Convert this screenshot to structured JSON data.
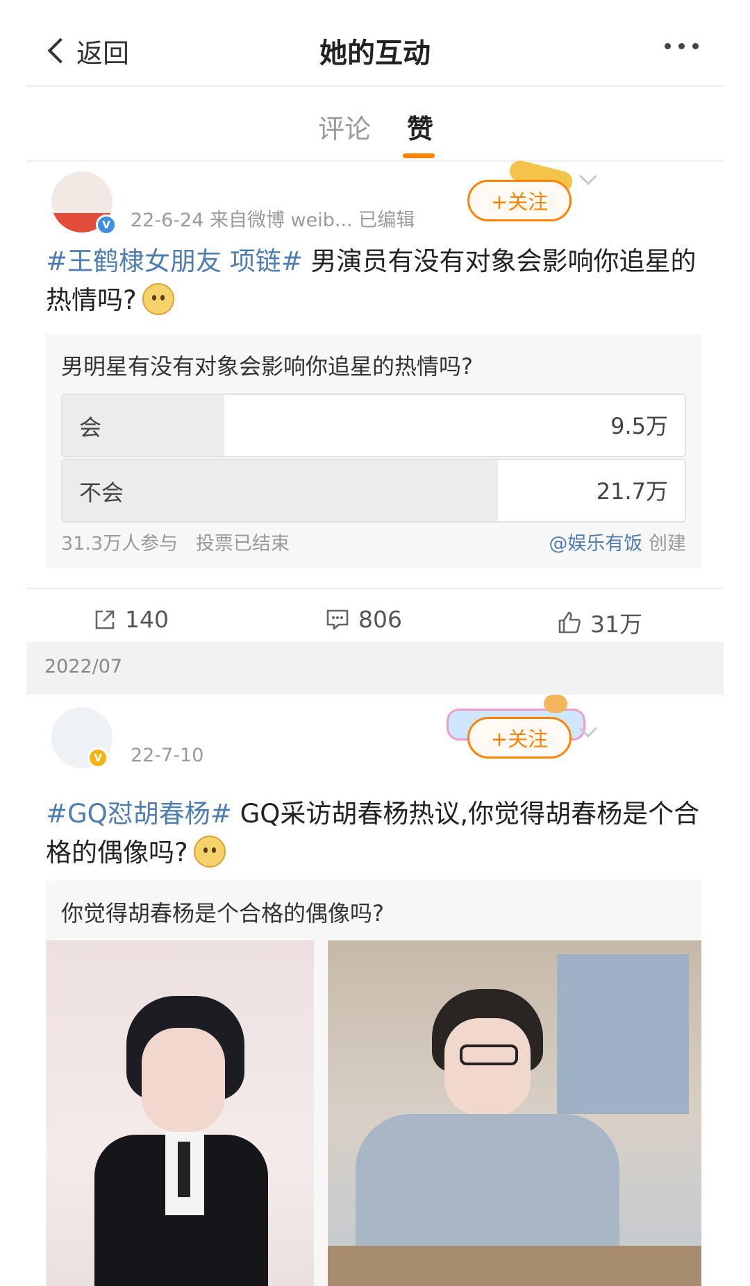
{
  "header": {
    "back_label": "返回",
    "title": "她的互动"
  },
  "tabs": [
    {
      "label": "评论",
      "active": false
    },
    {
      "label": "赞",
      "active": true
    }
  ],
  "posts": [
    {
      "meta": "22-6-24 来自微博 weib... 已编辑",
      "follow_label": "+关注",
      "topic": "#王鹤棣女朋友 项链#",
      "text": " 男演员有没有对象会影响你追星的热情吗?",
      "poll": {
        "question": "男明星有没有对象会影响你追星的热情吗?",
        "options": [
          {
            "label": "会",
            "count": "9.5万",
            "share": 0.3
          },
          {
            "label": "不会",
            "count": "21.7万",
            "share": 0.7
          }
        ],
        "participants": "31.3万人参与",
        "status": "投票已结束",
        "creator": "@娱乐有饭",
        "creator_suffix": "创建"
      },
      "actions": {
        "repost": "140",
        "comments": "806",
        "likes": "31万"
      }
    },
    {
      "meta": "22-7-10",
      "follow_label": "+关注",
      "topic": "#GQ怼胡春杨#",
      "text": " GQ采访胡春杨热议,你觉得胡春杨是个合格的偶像吗?",
      "poll": {
        "question": "你觉得胡春杨是个合格的偶像吗?"
      }
    }
  ],
  "month_separator": "2022/07",
  "colors": {
    "accent": "#ff8200",
    "link": "#507daf",
    "badge_blue": "#3d8fe0",
    "badge_gold": "#f5b40f"
  }
}
